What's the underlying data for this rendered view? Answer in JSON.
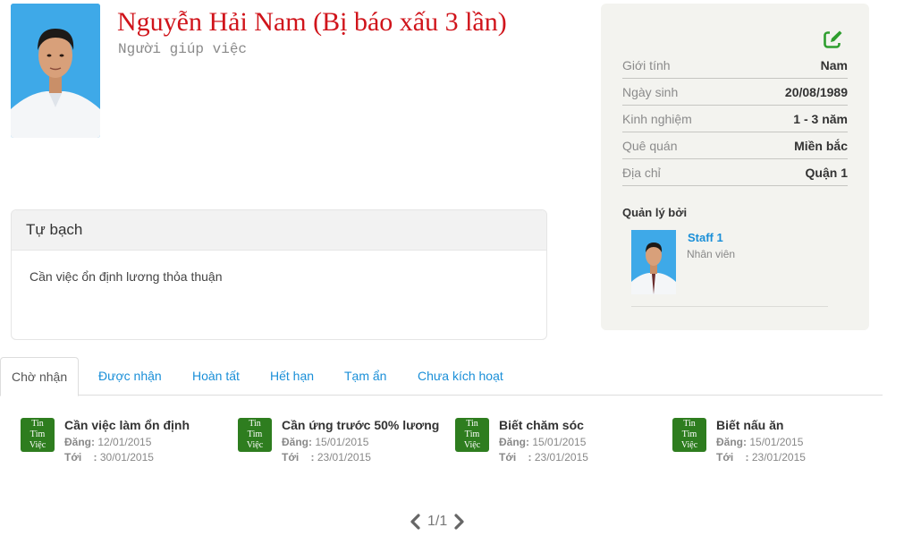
{
  "profile": {
    "name": "Nguyễn Hải Nam (Bị báo xấu 3 lần)",
    "role": "Người giúp việc"
  },
  "about": {
    "title": "Tự bạch",
    "text": "Cần việc ổn định lương thỏa thuận"
  },
  "info": [
    {
      "label": "Giới tính",
      "value": "Nam"
    },
    {
      "label": "Ngày sinh",
      "value": "20/08/1989"
    },
    {
      "label": "Kinh nghiệm",
      "value": "1 - 3 năm"
    },
    {
      "label": "Quê quán",
      "value": "Miền bắc"
    },
    {
      "label": "Địa chỉ",
      "value": "Quận 1"
    }
  ],
  "managed_by": {
    "title": "Quản lý bởi",
    "name": "Staff 1",
    "role": "Nhân viên"
  },
  "tabs": [
    "Chờ nhận",
    "Được nhận",
    "Hoàn tất",
    "Hết hạn",
    "Tạm ẩn",
    "Chưa kích hoạt"
  ],
  "job_icon_text": [
    "Tin",
    "Tìm",
    "Việc"
  ],
  "jobs": [
    {
      "title": "Cần việc làm ổn định",
      "posted_label": "Đăng:",
      "posted": "12/01/2015",
      "until_label": "Tới    :",
      "until": "30/01/2015"
    },
    {
      "title": "Cần ứng trước 50% lương",
      "posted_label": "Đăng:",
      "posted": "15/01/2015",
      "until_label": "Tới    :",
      "until": "23/01/2015"
    },
    {
      "title": "Biết chăm sóc",
      "posted_label": "Đăng:",
      "posted": "15/01/2015",
      "until_label": "Tới    :",
      "until": "23/01/2015"
    },
    {
      "title": "Biết nấu ăn",
      "posted_label": "Đăng:",
      "posted": "15/01/2015",
      "until_label": "Tới    :",
      "until": "23/01/2015"
    }
  ],
  "pager": {
    "text": "1/1"
  },
  "colors": {
    "name": "#d0141b",
    "link": "#1a8fd8",
    "edit_icon": "#2e9e2e",
    "job_icon": "#2e7d1f",
    "panel_bg": "#f3f3ef"
  },
  "icons": {
    "edit": "edit-icon",
    "prev": "chevron-left-icon",
    "next": "chevron-right-icon"
  }
}
